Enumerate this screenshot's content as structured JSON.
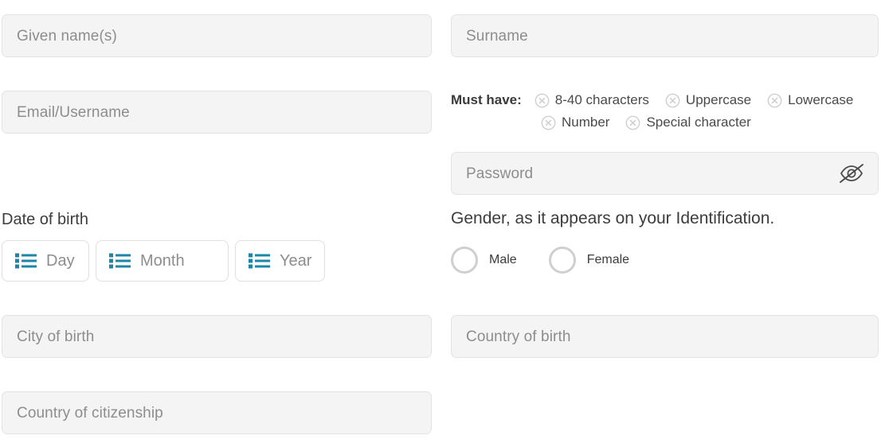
{
  "form": {
    "fields": {
      "given_name": {
        "placeholder": "Given name(s)",
        "value": ""
      },
      "surname": {
        "placeholder": "Surname",
        "value": ""
      },
      "email_username": {
        "placeholder": "Email/Username",
        "value": ""
      },
      "password": {
        "placeholder": "Password",
        "value": "",
        "toggle_icon": "eye-slash-icon"
      },
      "city_of_birth": {
        "placeholder": "City of birth",
        "value": ""
      },
      "country_of_birth": {
        "placeholder": "Country of birth",
        "value": ""
      },
      "country_of_citizenship": {
        "placeholder": "Country of citizenship",
        "value": ""
      }
    },
    "password_requirements": {
      "label": "Must have:",
      "items": [
        {
          "text": "8-40 characters",
          "icon": "circle-x-icon",
          "met": false
        },
        {
          "text": "Uppercase",
          "icon": "circle-x-icon",
          "met": false
        },
        {
          "text": "Lowercase",
          "icon": "circle-x-icon",
          "met": false
        },
        {
          "text": "Number",
          "icon": "circle-x-icon",
          "met": false
        },
        {
          "text": "Special character",
          "icon": "circle-x-icon",
          "met": false
        }
      ]
    },
    "date_of_birth": {
      "label": "Date of birth",
      "selectors": [
        {
          "placeholder": "Day",
          "icon": "list-icon",
          "value": ""
        },
        {
          "placeholder": "Month",
          "icon": "list-icon",
          "value": ""
        },
        {
          "placeholder": "Year",
          "icon": "list-icon",
          "value": ""
        }
      ]
    },
    "gender": {
      "label": "Gender, as it appears on your Identification.",
      "options": [
        {
          "label": "Male",
          "selected": false
        },
        {
          "label": "Female",
          "selected": false
        }
      ]
    }
  },
  "colors": {
    "field_background": "#f4f4f4",
    "field_border": "#e3e3e3",
    "placeholder_text": "#8d8d8d",
    "label_text": "#3c3c3c",
    "accent_icon": "#1b86a8",
    "requirement_icon": "#cfcfcf",
    "radio_border": "#cfcfcf"
  }
}
